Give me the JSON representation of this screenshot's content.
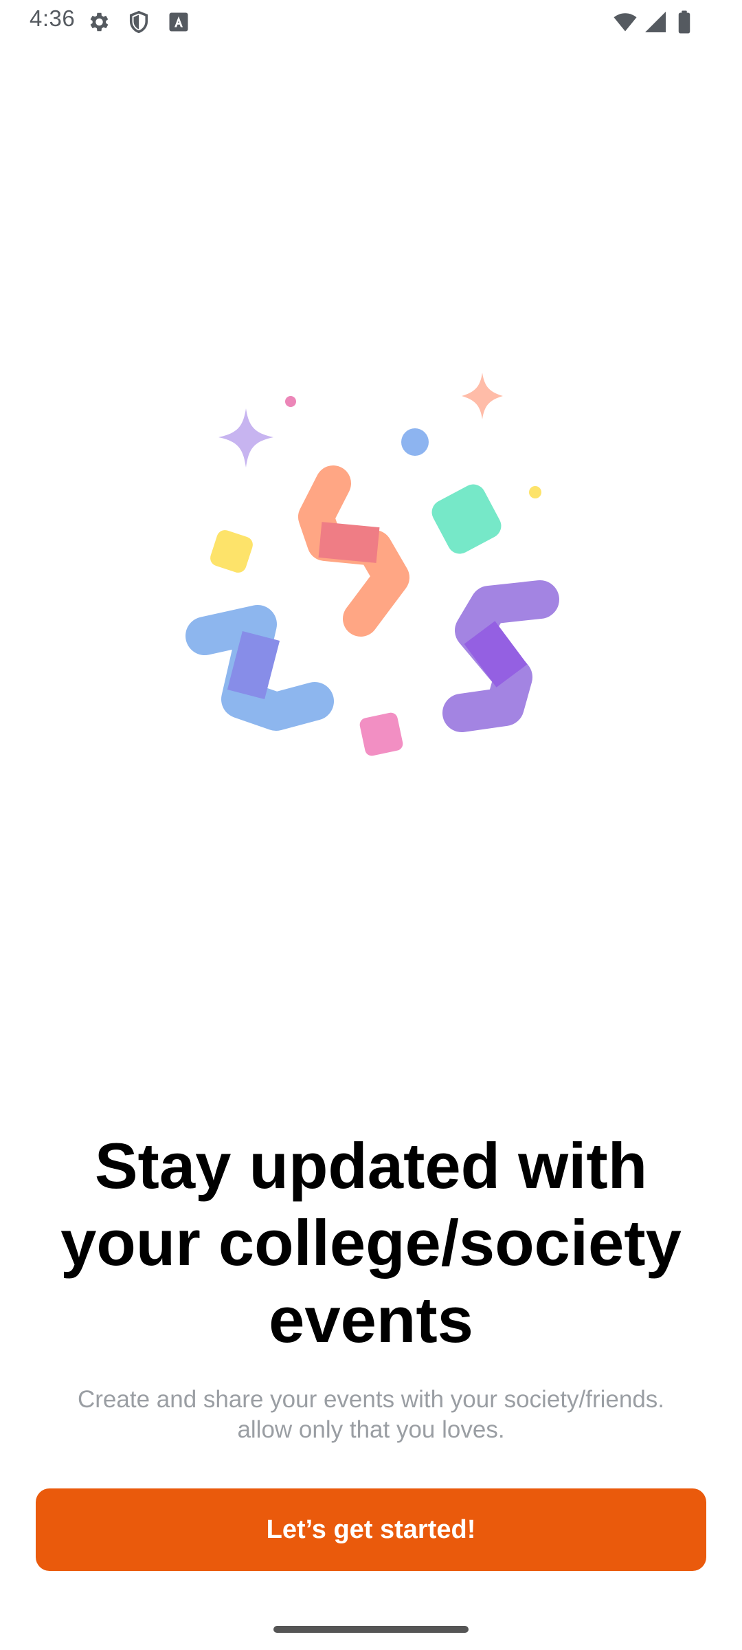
{
  "status_bar": {
    "time": "4:36",
    "icons": [
      "gear-icon",
      "shield-icon",
      "text-a-icon",
      "wifi-icon",
      "signal-icon",
      "battery-icon"
    ]
  },
  "onboarding": {
    "illustration": "confetti-illustration",
    "title_lines": [
      "Stay updated with",
      "your college/society",
      "events"
    ],
    "subtitle_lines": [
      "Create and share your events with your society/friends.",
      "allow only that you loves."
    ],
    "cta_label": "Let’s get started!"
  },
  "colors": {
    "accent": "#ea5a0c",
    "subtitle": "#9a9ea3",
    "title": "#000000"
  }
}
